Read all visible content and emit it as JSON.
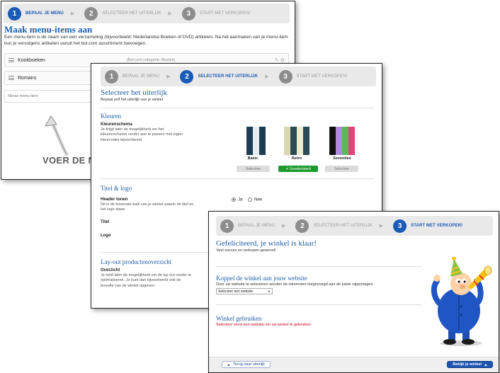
{
  "panel1": {
    "steps": [
      {
        "num": "1",
        "label": "BEPAAL JE MENU"
      },
      {
        "num": "2",
        "label": "SELECTEER HET UITERLIJK"
      },
      {
        "num": "3",
        "label": "START MET VERKOPEN!"
      }
    ],
    "title": "Maak menu-items aan",
    "intro": "Een menu-item is de naam van een verzameling (bijvoorbeeld: Nederlandse Boeken of DVD) artikelen. Na het aanmaken van je menu-item kun je vervolgens artikelen vanuit het bol.com assortiment toevoegen.",
    "items": [
      {
        "name": "Kookboeken",
        "category": "(Bol.com categorie: Muziek)"
      },
      {
        "name": "Romans",
        "category": ""
      }
    ],
    "new_item_placeholder": "Nieuw menu-item",
    "hint": "VOER DE NA"
  },
  "panel2": {
    "steps": [
      {
        "num": "1",
        "label": "BEPAAL JE MENU"
      },
      {
        "num": "2",
        "label": "SELECTEER HET UITERLIJK"
      },
      {
        "num": "3",
        "label": "START MET VERKOPEN!"
      }
    ],
    "title": "Selecteer het uiterlijk",
    "subtitle": "Bepaal zelf het uiterlijk van je winkel",
    "colors": {
      "heading": "Kleuren",
      "scheme_label": "Kleurenschema",
      "scheme_desc": "Je krijgt later de mogelijkheid om het kleurenschema verder aan te passen met eigen kleurcodes bijvoorbeeld.",
      "themes": [
        {
          "name": "Basic",
          "button": "Selecteer",
          "selected": false,
          "colors": [
            "#ffffff",
            "#1d3d52",
            "#e6ecef",
            "#1d3d52"
          ]
        },
        {
          "name": "Retro",
          "button": "Geselecteerd",
          "selected": true,
          "colors": [
            "#d8d8b4",
            "#2a4a58",
            "#ecebd0",
            "#2a4a58"
          ]
        },
        {
          "name": "Seventies",
          "button": "Selecteer",
          "selected": false,
          "colors": [
            "#111111",
            "#a98dd8",
            "#5bb85a",
            "#e5427a"
          ]
        }
      ]
    },
    "logo_section": {
      "heading": "Titel & logo",
      "header_label": "Header tonen",
      "header_desc": "Dit is de bovenste balk van je winkel waarin de titel en het logo staan",
      "yes": "Ja",
      "no": "Nee",
      "title_label": "Titel",
      "logo_label": "Logo"
    },
    "layout": {
      "heading": "Lay-out productenoverzicht",
      "overview_label": "Overzicht",
      "overview_desc": "Je hebt later de mogelijkheid om de lay-out verder te optimaliseren. Je kunt dan bijvoorbeeld ook de breedte van de winkel opgeven."
    }
  },
  "panel3": {
    "steps": [
      {
        "num": "1",
        "label": "BEPAAL JE MENU"
      },
      {
        "num": "2",
        "label": "SELECTEER HET UITERLIJK"
      },
      {
        "num": "3",
        "label": "START MET VERKOPEN!"
      }
    ],
    "title": "Gefeliciteerd, je winkel is klaar!",
    "subtitle": "Veel succes en verkopen gewenst!",
    "connect_heading": "Koppel de winkel aan jouw website",
    "connect_desc": "Door uw website te selecteren worden de inkomsten toegevoegd aan de juiste rapportages.",
    "select_value": "Selecteer een website",
    "use_heading": "Winkel gebruiken",
    "use_warning": "Selecteer eerst een website om uw winkel te gebruiken",
    "back_button": "Terug naar uiterlijk",
    "view_button": "Bekijk je winkel"
  },
  "colors": {
    "accent_blue": "#1a5bb8",
    "title_blue": "#1e5ea8",
    "green": "#1e9a2c",
    "warning_red": "#d0021b"
  }
}
